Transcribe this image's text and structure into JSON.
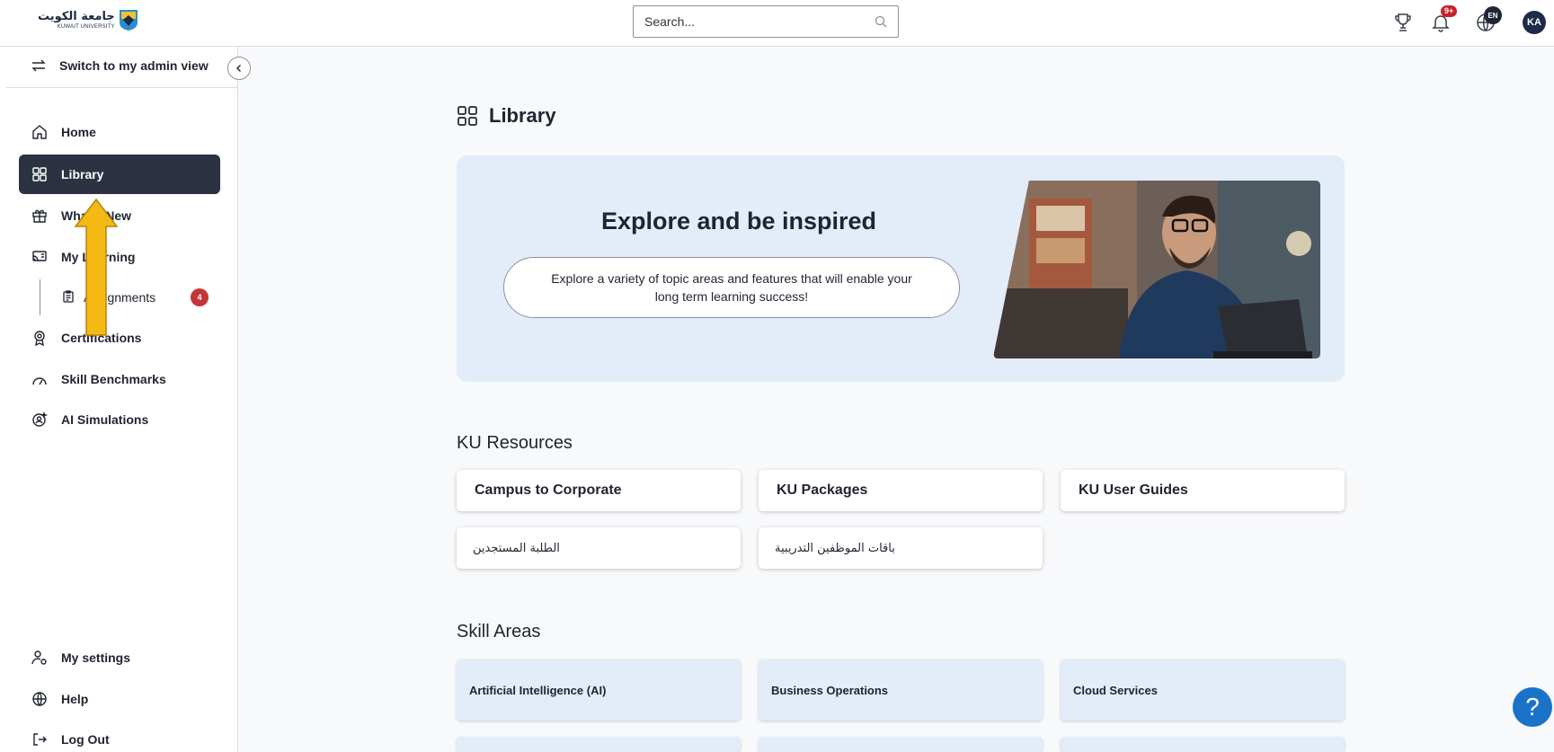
{
  "header": {
    "logo_arabic": "جامعة الكويت",
    "logo_english": "KUWAIT UNIVERSITY",
    "search_placeholder": "Search...",
    "notifications_badge": "9+",
    "language_badge": "EN",
    "avatar_initials": "KA"
  },
  "sidebar": {
    "switch_label": "Switch to my admin view",
    "items": [
      {
        "label": "Home",
        "icon": "home-icon"
      },
      {
        "label": "Library",
        "icon": "grid-icon",
        "active": true
      },
      {
        "label": "What's New",
        "icon": "gift-icon"
      },
      {
        "label": "My Learning",
        "icon": "learning-icon"
      },
      {
        "label": "Certifications",
        "icon": "certification-icon"
      },
      {
        "label": "Skill Benchmarks",
        "icon": "gauge-icon"
      },
      {
        "label": "AI Simulations",
        "icon": "ai-simulation-icon"
      }
    ],
    "sub_items": [
      {
        "label": "Assignments",
        "icon": "clipboard-icon",
        "count": "4"
      }
    ],
    "bottom_items": [
      {
        "label": "My settings",
        "icon": "settings-user-icon"
      },
      {
        "label": "Help",
        "icon": "help-globe-icon"
      },
      {
        "label": "Log Out",
        "icon": "logout-icon"
      }
    ]
  },
  "main": {
    "title": "Library",
    "hero": {
      "title": "Explore and be inspired",
      "description": "Explore a variety of topic areas and features that will enable your long term learning success!"
    },
    "ku_resources": {
      "title": "KU Resources",
      "cards": [
        "Campus to Corporate",
        "KU Packages",
        "KU User Guides",
        "الطلبة المستجدين",
        "باقات الموظفين التدريبية"
      ]
    },
    "skill_areas": {
      "title": "Skill Areas",
      "cards": [
        "Artificial Intelligence (AI)",
        "Business Operations",
        "Cloud Services"
      ]
    },
    "help_fab": "?"
  },
  "colors": {
    "sidebar_active_bg": "#2c3242",
    "hero_bg": "#e3ecf9",
    "badge_red": "#c23538",
    "annotation_arrow": "#f5b914",
    "help_fab": "#1a73c9"
  }
}
